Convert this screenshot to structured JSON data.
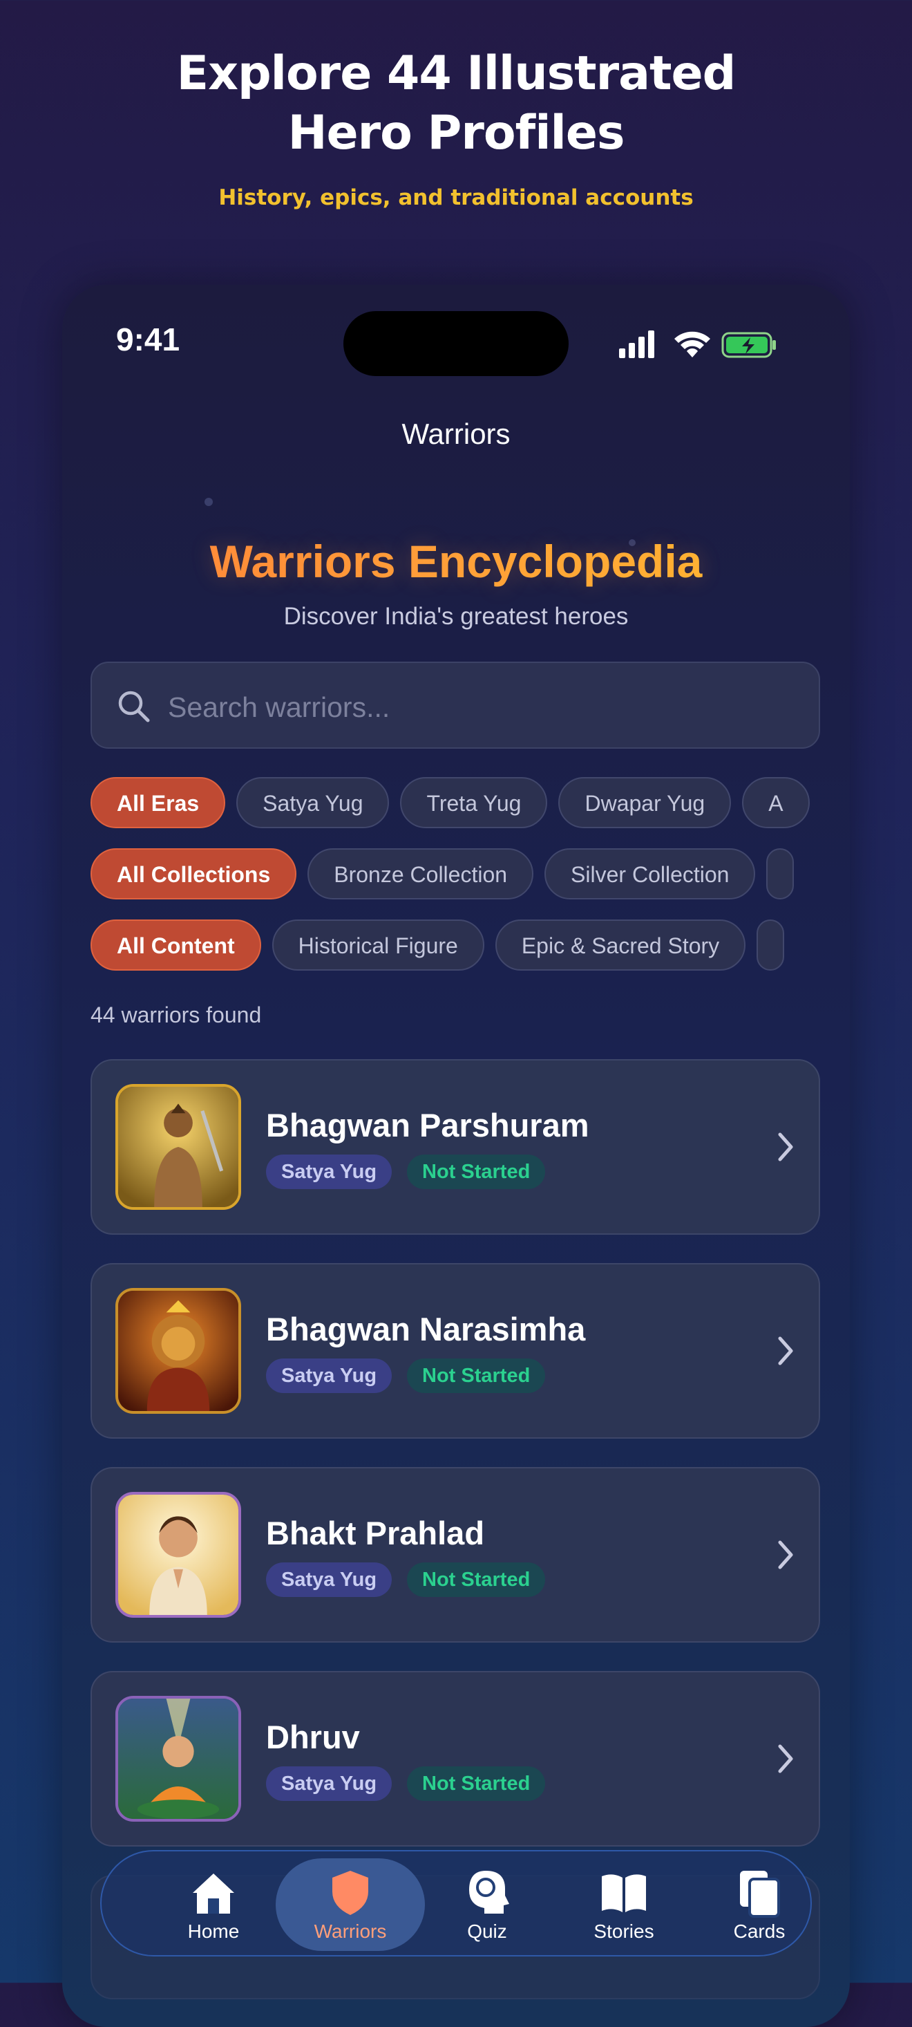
{
  "promo": {
    "title_line1": "Explore 44 Illustrated",
    "title_line2": "Hero Profiles",
    "subtitle": "History, epics, and traditional accounts"
  },
  "status_bar": {
    "time": "9:41"
  },
  "nav": {
    "title": "Warriors"
  },
  "header": {
    "title": "Warriors Encyclopedia",
    "subtitle": "Discover India's greatest heroes"
  },
  "search": {
    "placeholder": "Search warriors..."
  },
  "filters": {
    "eras": [
      "All Eras",
      "Satya Yug",
      "Treta Yug",
      "Dwapar Yug",
      "A"
    ],
    "collections": [
      "All Collections",
      "Bronze Collection",
      "Silver Collection"
    ],
    "content": [
      "All Content",
      "Historical Figure",
      "Epic & Sacred Story"
    ]
  },
  "results": {
    "count_text": "44 warriors found"
  },
  "warriors": [
    {
      "name": "Bhagwan Parshuram",
      "era": "Satya Yug",
      "status": "Not Started"
    },
    {
      "name": "Bhagwan Narasimha",
      "era": "Satya Yug",
      "status": "Not Started"
    },
    {
      "name": "Bhakt Prahlad",
      "era": "Satya Yug",
      "status": "Not Started"
    },
    {
      "name": "Dhruv",
      "era": "Satya Yug",
      "status": "Not Started"
    }
  ],
  "tabbar": {
    "items": [
      {
        "label": "Home",
        "icon": "home-icon"
      },
      {
        "label": "Warriors",
        "icon": "shield-icon",
        "active": true
      },
      {
        "label": "Quiz",
        "icon": "brain-head-icon"
      },
      {
        "label": "Stories",
        "icon": "book-icon"
      },
      {
        "label": "Cards",
        "icon": "cards-icon"
      }
    ]
  },
  "colors": {
    "accent": "#bf4a33",
    "title_gradient_start": "#ff7a3a",
    "title_gradient_end": "#ffc42e",
    "status_green": "#2bd18f",
    "promo_yellow": "#f2c12e"
  }
}
